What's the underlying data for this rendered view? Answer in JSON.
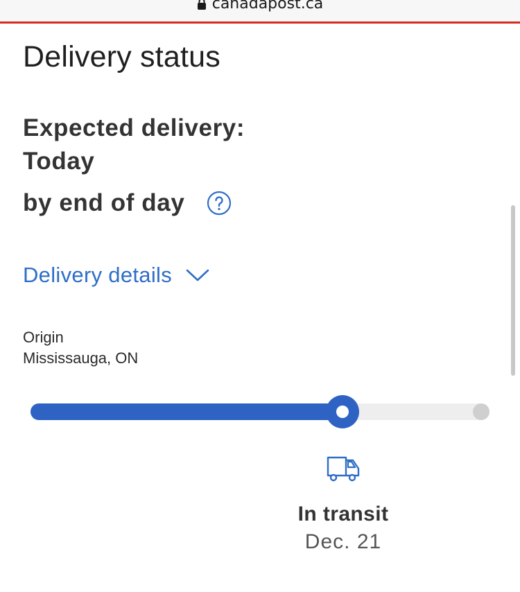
{
  "browser": {
    "url": "canadapost.ca"
  },
  "colors": {
    "brand_line": "#d52b1e",
    "accent": "#2e63c4",
    "link": "#2e6ec6"
  },
  "page": {
    "title": "Delivery status"
  },
  "expected": {
    "label": "Expected delivery:",
    "day": "Today",
    "time": "by end of day",
    "help_icon": "question-circle-icon"
  },
  "details": {
    "label": "Delivery details",
    "chevron_icon": "chevron-down-icon"
  },
  "origin": {
    "label": "Origin",
    "value": "Mississauga, ON"
  },
  "progress": {
    "fraction": 0.68
  },
  "status": {
    "icon": "truck-icon",
    "label": "In transit",
    "date": "Dec. 21"
  }
}
